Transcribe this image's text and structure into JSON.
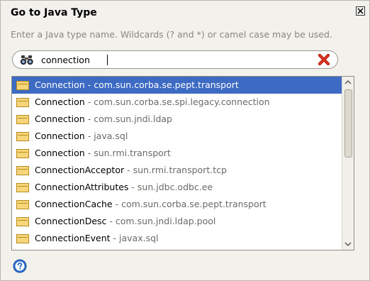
{
  "dialog": {
    "title": "Go to Java Type",
    "subtitle": "Enter a Java type name.  Wildcards (? and *) or camel case may be used."
  },
  "search": {
    "value": "connection",
    "icon": "binoculars-icon",
    "clear_icon": "clear-x-icon"
  },
  "results": [
    {
      "name": "Connection",
      "sep": " - ",
      "package": "com.sun.corba.se.pept.transport",
      "selected": true
    },
    {
      "name": "Connection",
      "sep": " - ",
      "package": "com.sun.corba.se.spi.legacy.connection",
      "selected": false
    },
    {
      "name": "Connection",
      "sep": " - ",
      "package": "com.sun.jndi.ldap",
      "selected": false
    },
    {
      "name": "Connection",
      "sep": " - ",
      "package": "java.sql",
      "selected": false
    },
    {
      "name": "Connection",
      "sep": " - ",
      "package": "sun.rmi.transport",
      "selected": false
    },
    {
      "name": "ConnectionAcceptor",
      "sep": " - ",
      "package": "sun.rmi.transport.tcp",
      "selected": false
    },
    {
      "name": "ConnectionAttributes",
      "sep": " - ",
      "package": "sun.jdbc.odbc.ee",
      "selected": false
    },
    {
      "name": "ConnectionCache",
      "sep": " - ",
      "package": "com.sun.corba.se.pept.transport",
      "selected": false
    },
    {
      "name": "ConnectionDesc",
      "sep": " - ",
      "package": "com.sun.jndi.ldap.pool",
      "selected": false
    },
    {
      "name": "ConnectionEvent",
      "sep": " - ",
      "package": "javax.sql",
      "selected": false
    }
  ],
  "footer": {
    "help_icon": "help-icon"
  },
  "colors": {
    "selection": "#3d6bc4",
    "dialog_bg": "#f2f1ec",
    "clear_icon": "#d6281c"
  }
}
